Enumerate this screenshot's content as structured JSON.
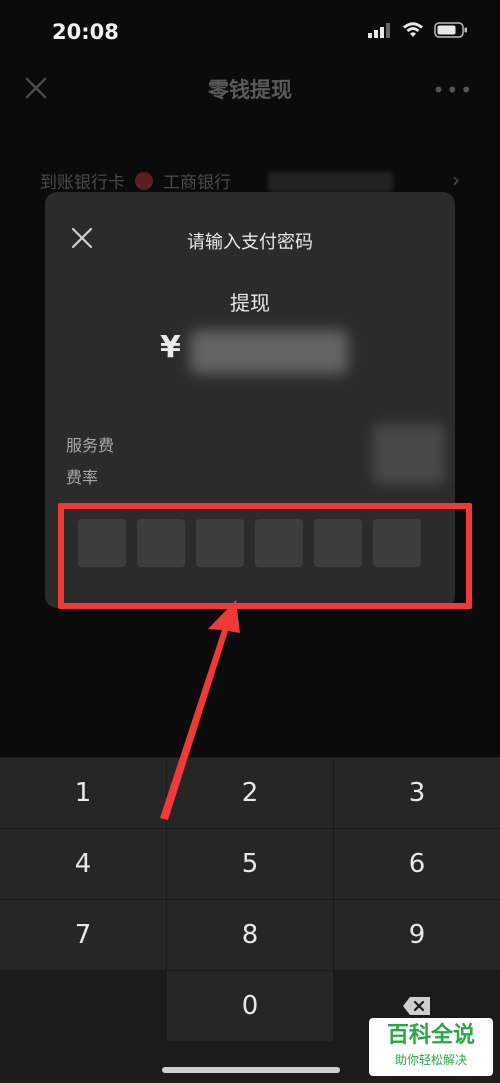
{
  "status_bar": {
    "time": "20:08"
  },
  "background_page": {
    "title": "零钱提现",
    "bank_row_label": "到账银行卡",
    "bank_name": "工商银行"
  },
  "modal": {
    "title": "请输入支付密码",
    "action_label": "提现",
    "currency_symbol": "¥",
    "fee_label": "服务费",
    "rate_label": "费率",
    "pin_length": 6
  },
  "keypad": {
    "keys": [
      "1",
      "2",
      "3",
      "4",
      "5",
      "6",
      "7",
      "8",
      "9",
      "",
      "0",
      "⌫"
    ]
  },
  "watermark": {
    "main": "百科全说",
    "sub": "助你轻松解决"
  },
  "colors": {
    "highlight": "#f03a3a",
    "watermark_green": "#2aa845"
  }
}
